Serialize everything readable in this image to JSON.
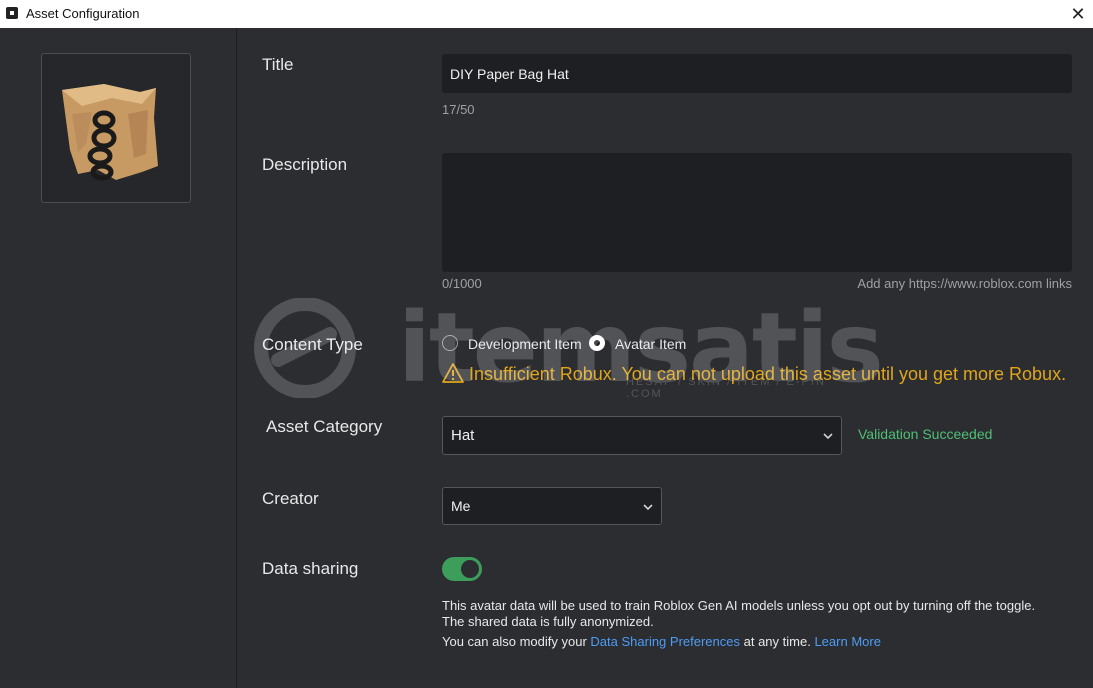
{
  "window": {
    "title": "Asset Configuration"
  },
  "form": {
    "title_label": "Title",
    "title_value": "DIY Paper Bag Hat",
    "title_count": "17/50",
    "description_label": "Description",
    "description_value": "",
    "description_count": "0/1000",
    "description_hint": "Add any https://www.roblox.com links",
    "content_type_label": "Content Type",
    "content_type_options": [
      {
        "label": "Development Item",
        "selected": false
      },
      {
        "label": "Avatar Item",
        "selected": true
      }
    ],
    "warning_text": "Insufficient Robux. You can not upload this asset until you get more Robux.",
    "asset_category_label": "Asset Category",
    "asset_category_value": "Hat",
    "validation_text": "Validation Succeeded",
    "creator_label": "Creator",
    "creator_value": "Me",
    "data_sharing_label": "Data sharing",
    "data_sharing_enabled": true,
    "data_sharing_info_1": "This avatar data will be used to train Roblox Gen AI models unless you opt out by turning off the toggle.",
    "data_sharing_info_2": "The shared data is fully anonymized.",
    "data_sharing_info_3_prefix": "You can also modify your",
    "data_sharing_link": "Data Sharing Preferences",
    "data_sharing_info_3_suffix": "at any time.",
    "learn_more": "Learn More"
  },
  "watermark": {
    "text": "itemsatis",
    "sub": "HESAP / SKIN / ITEM / E-PIN .COM"
  },
  "colors": {
    "accent": "#3d9e5b",
    "warning": "#e0a51c",
    "link": "#4d9cf5",
    "success": "#4fbf74"
  }
}
